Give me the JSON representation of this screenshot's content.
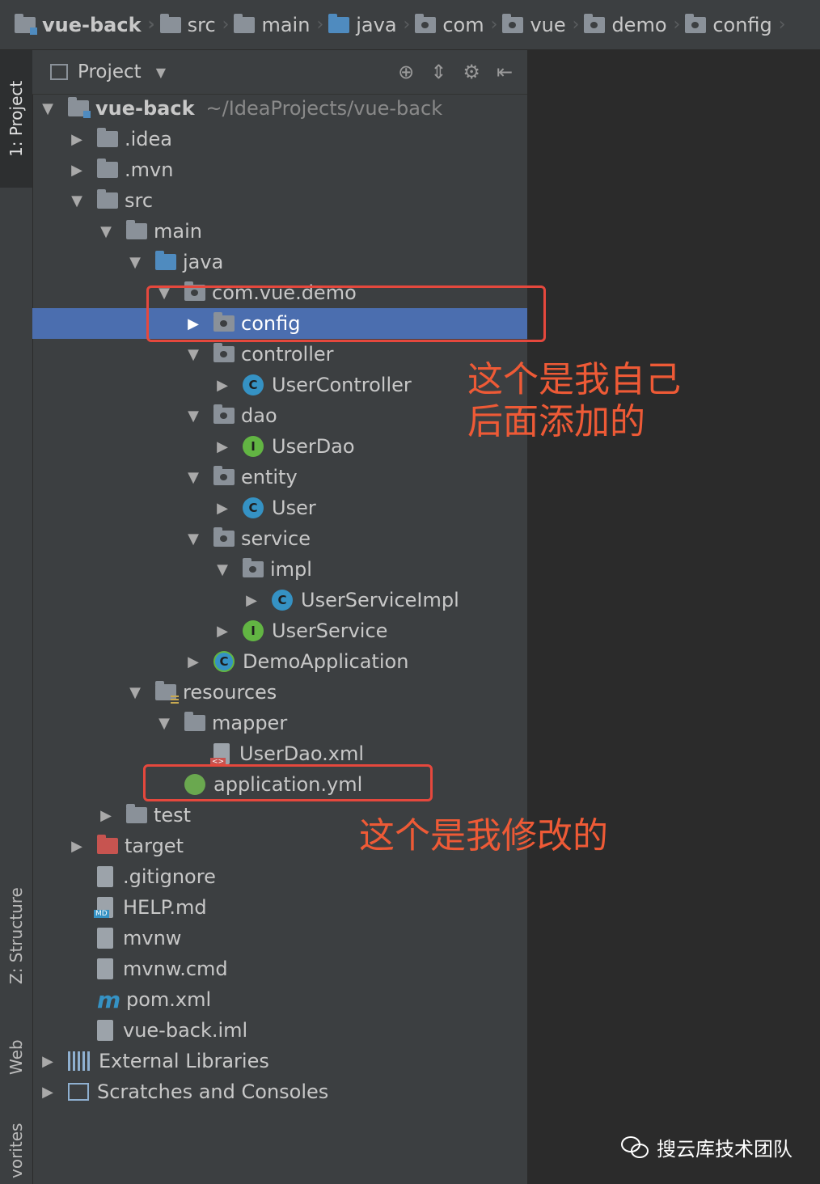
{
  "breadcrumb": [
    "vue-back",
    "src",
    "main",
    "java",
    "com",
    "vue",
    "demo",
    "config"
  ],
  "toolwindows": {
    "project": "1: Project",
    "structure": "Z: Structure",
    "web": "Web",
    "favorites": "vorites"
  },
  "panel": {
    "title": "Project",
    "tools": [
      "target-icon",
      "collapse-icon",
      "gear-icon",
      "hide-icon"
    ]
  },
  "tree": {
    "root": {
      "label": "vue-back",
      "path": "~/IdeaProjects/vue-back"
    },
    "idea": ".idea",
    "mvn": ".mvn",
    "src": "src",
    "main": "main",
    "java": "java",
    "pkg": "com.vue.demo",
    "config": "config",
    "controller": "controller",
    "user_controller": "UserController",
    "dao": "dao",
    "user_dao": "UserDao",
    "entity": "entity",
    "user": "User",
    "service": "service",
    "impl": "impl",
    "user_service_impl": "UserServiceImpl",
    "user_service": "UserService",
    "demo_application": "DemoApplication",
    "resources": "resources",
    "mapper": "mapper",
    "user_dao_xml": "UserDao.xml",
    "application_yml": "application.yml",
    "test": "test",
    "target": "target",
    "gitignore": ".gitignore",
    "help_md": "HELP.md",
    "mvnw": "mvnw",
    "mvnw_cmd": "mvnw.cmd",
    "pom": "pom.xml",
    "iml": "vue-back.iml",
    "external_libraries": "External Libraries",
    "scratches": "Scratches and Consoles"
  },
  "icons": {
    "class_letter": "C",
    "interface_letter": "I",
    "maven_letter": "m"
  },
  "annotations": {
    "note1_line1": "这个是我自己",
    "note1_line2": "后面添加的",
    "note2": "这个是我修改的",
    "color": "#ee5a36"
  },
  "watermark": "搜云库技术团队",
  "colors": {
    "selection": "#4b6eaf",
    "panel": "#3c3f41",
    "editor": "#2b2b2b"
  }
}
